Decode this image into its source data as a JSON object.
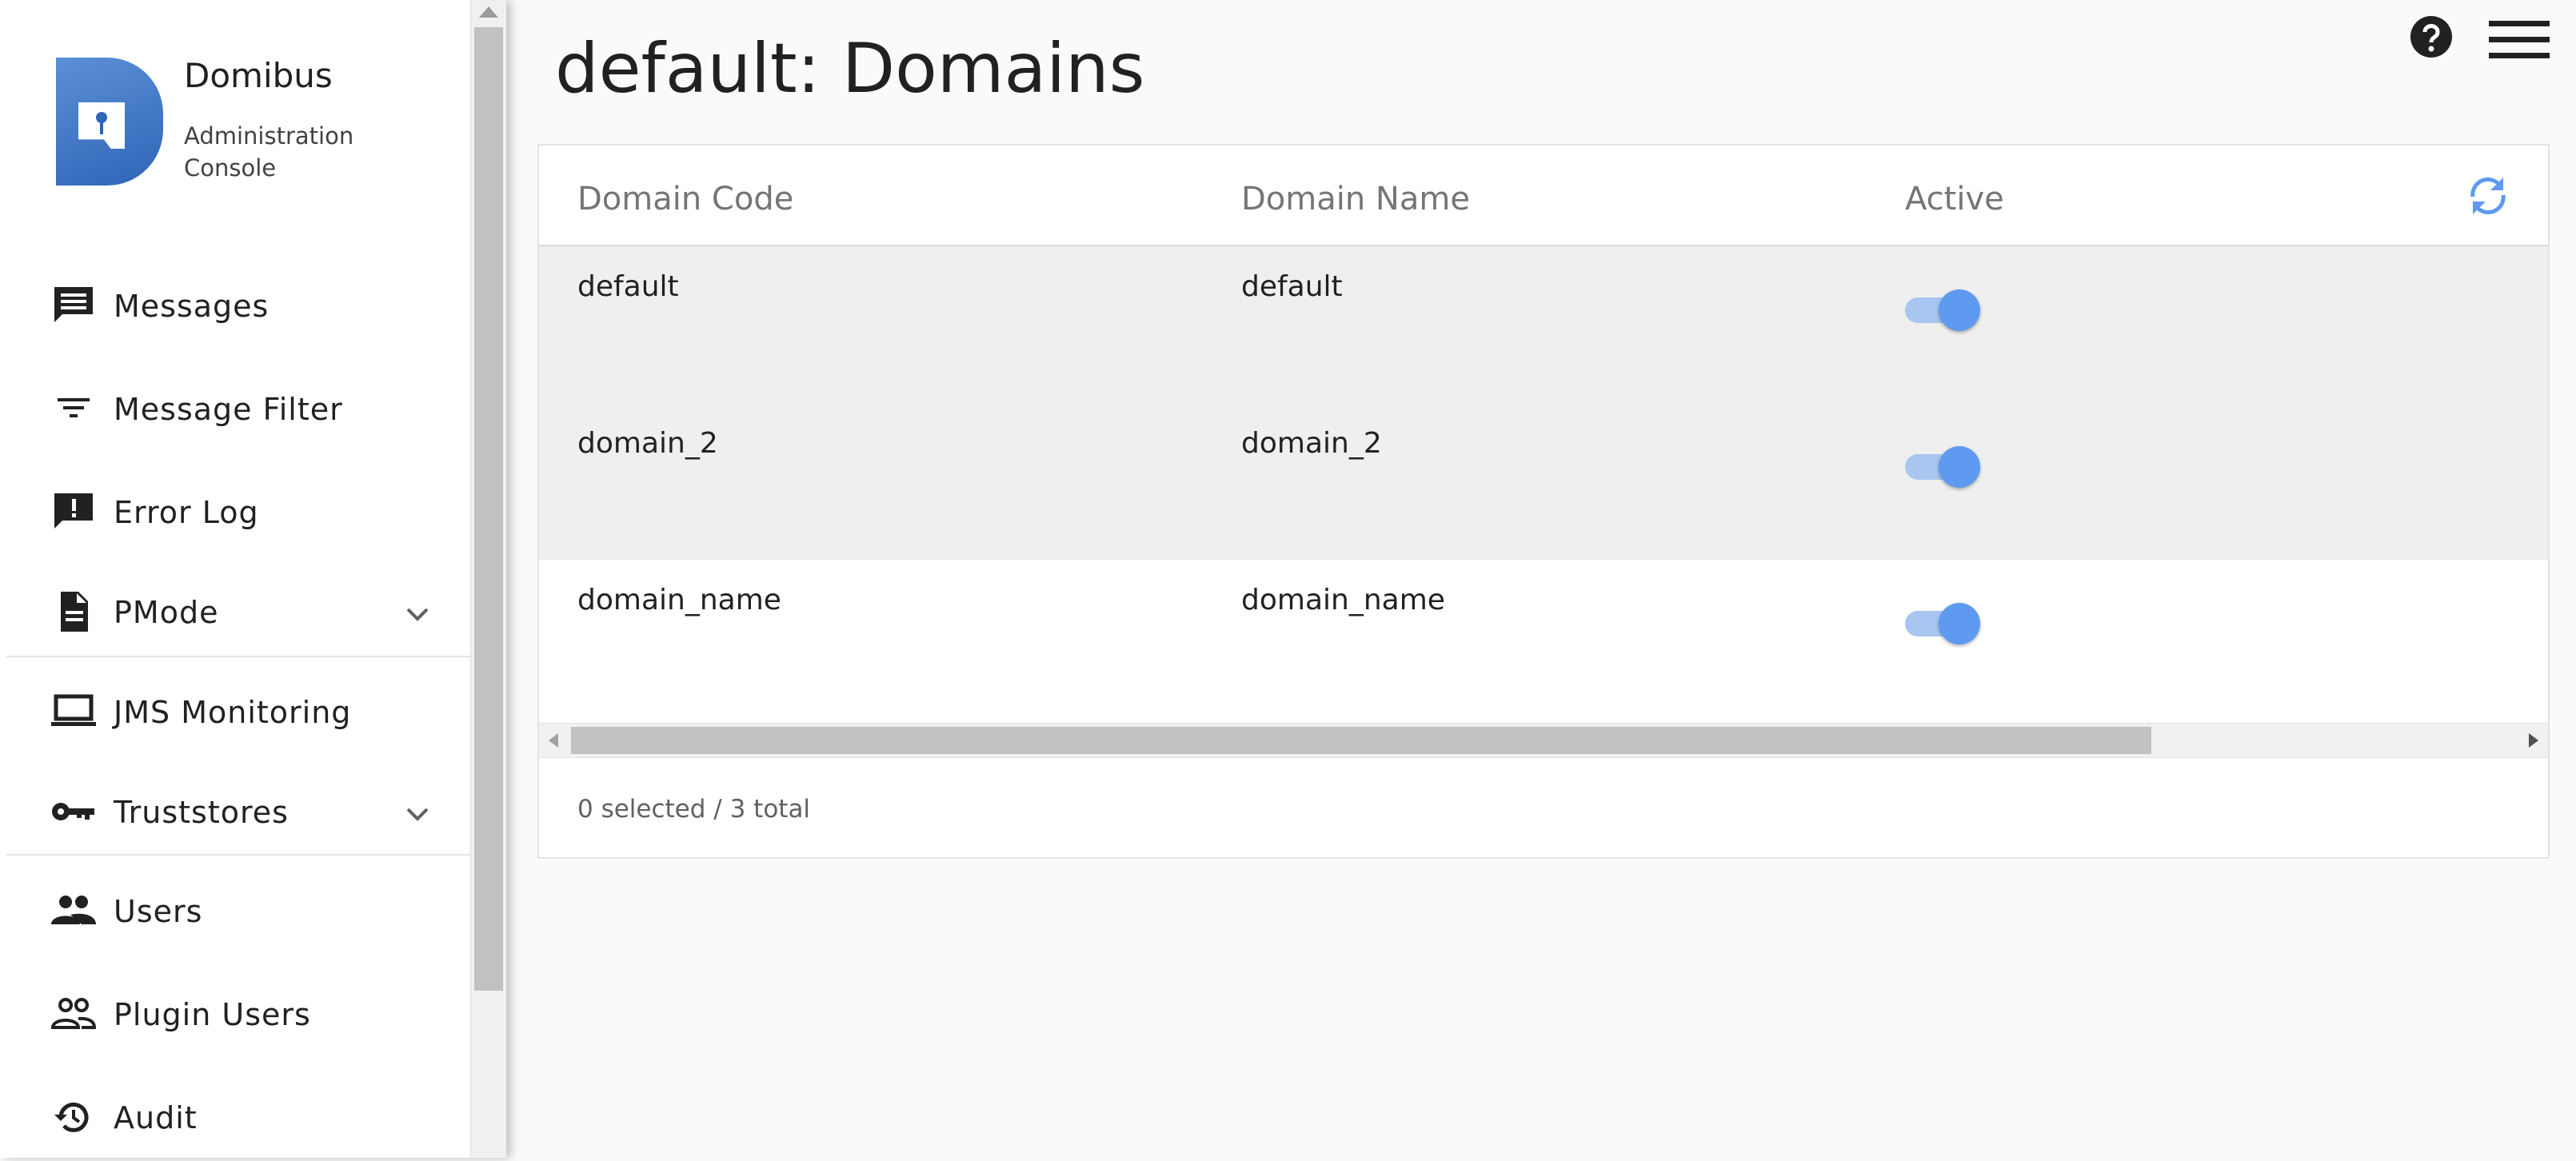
{
  "app": {
    "name": "Domibus",
    "subtitle": "Administration Console"
  },
  "page": {
    "title": "default: Domains"
  },
  "sidebar": {
    "items": [
      {
        "label": "Messages",
        "icon": "message-icon"
      },
      {
        "label": "Message Filter",
        "icon": "filter-icon"
      },
      {
        "label": "Error Log",
        "icon": "error-log-icon"
      },
      {
        "label": "PMode",
        "icon": "document-icon",
        "expandable": true
      },
      {
        "label": "JMS Monitoring",
        "icon": "laptop-icon"
      },
      {
        "label": "Truststores",
        "icon": "key-icon",
        "expandable": true
      },
      {
        "label": "Users",
        "icon": "users-icon"
      },
      {
        "label": "Plugin Users",
        "icon": "plugin-users-icon"
      },
      {
        "label": "Audit",
        "icon": "history-icon"
      }
    ]
  },
  "table": {
    "columns": [
      "Domain Code",
      "Domain Name",
      "Active"
    ],
    "rows": [
      {
        "code": "default",
        "name": "default",
        "active": true
      },
      {
        "code": "domain_2",
        "name": "domain_2",
        "active": true
      },
      {
        "code": "domain_name",
        "name": "domain_name",
        "active": true
      }
    ],
    "footer": "0 selected / 3 total"
  },
  "colors": {
    "accent": "#5d9af0",
    "logo": "#2f65b8",
    "row_shade": "#efefef"
  }
}
